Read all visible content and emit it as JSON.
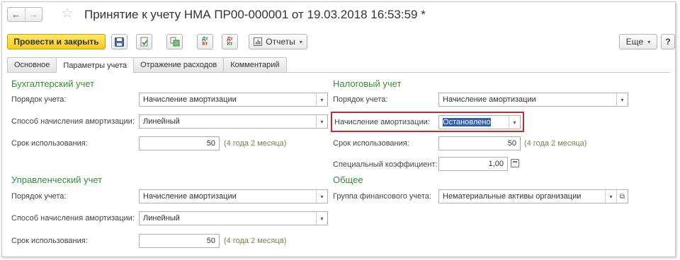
{
  "window": {
    "title": "Принятие к учету НМА ПР00-000001 от 19.03.2018 16:53:59 *",
    "nav_back": "←",
    "nav_forward": "→",
    "favorite_star": "☆"
  },
  "toolbar": {
    "post_and_close": "Провести и закрыть",
    "reports": "Отчеты",
    "more": "Еще",
    "help": "?",
    "dropdown_caret": "▾",
    "dt_label": "Дт",
    "kt_label": "Кт",
    "icons": [
      "save-icon",
      "post-document-icon",
      "structure-icon",
      "dt-kt-postings-icon",
      "dt-kt-reverse-icon",
      "reports-icon"
    ]
  },
  "tabs": [
    "Основное",
    "Параметры учета",
    "Отражение расходов",
    "Комментарий"
  ],
  "active_tab": 1,
  "accounting": {
    "title": "Бухгалтерский учет",
    "order_label": "Порядок учета:",
    "order_value": "Начисление амортизации",
    "method_label": "Способ начисления амортизации:",
    "method_value": "Линейный",
    "term_label": "Срок использования:",
    "term_value": "50",
    "term_hint": "(4 года 2 месяца)"
  },
  "management": {
    "title": "Управленческий учет",
    "order_label": "Порядок учета:",
    "order_value": "Начисление амортизации",
    "method_label": "Способ начисления амортизации:",
    "method_value": "Линейный",
    "term_label": "Срок использования:",
    "term_value": "50",
    "term_hint": "(4 года 2 месяца)"
  },
  "tax": {
    "title": "Налоговый учет",
    "order_label": "Порядок учета:",
    "order_value": "Начисление амортизации",
    "depreciation_label": "Начисление амортизации:",
    "depreciation_value": "Остановлено",
    "term_label": "Срок использования:",
    "term_value": "50",
    "term_hint": "(4 года 2 месяца)",
    "coef_label": "Специальный коэффициент:",
    "coef_value": "1,00"
  },
  "general": {
    "title": "Общее",
    "fin_group_label": "Группа финансового учета:",
    "fin_group_value": "Нематериальные активы организации",
    "open_icon": "⧉"
  },
  "colors": {
    "primary_button": "#f3cb1c",
    "group_title": "#3a8a3a",
    "highlight_border": "#cc2b2b",
    "selection": "#2f5fb8"
  }
}
